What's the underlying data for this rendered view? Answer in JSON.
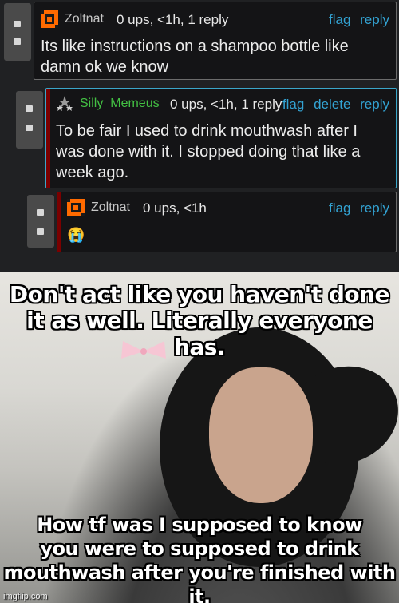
{
  "comments": [
    {
      "user": "Zoltnat",
      "meta": "0 ups, <1h, 1 reply",
      "actions": [
        "flag",
        "reply"
      ],
      "text_lines": [
        "Its like instructions on a shampoo bottle like",
        "damn ok we know"
      ],
      "avatar_icon": "pixel-avatar-icon"
    },
    {
      "user": "Silly_Memeus",
      "meta": "0 ups, <1h, 1 reply",
      "actions": [
        "flag",
        "delete",
        "reply"
      ],
      "text_lines": [
        "To be fair I used to drink mouthwash after I",
        "was done with it. I stopped doing that like a",
        "week ago."
      ],
      "avatar_icon": "stars-avatar-icon"
    },
    {
      "user": "Zoltnat",
      "meta": "0 ups, <1h",
      "actions": [
        "flag",
        "reply"
      ],
      "text_lines": [
        "😭"
      ],
      "avatar_icon": "pixel-avatar-icon"
    }
  ],
  "meme": {
    "top_caption": [
      "Don't act like you haven't done",
      "it as well. Literally everyone has."
    ],
    "bottom_caption": [
      "How tf was I supposed to know",
      "you were to supposed to drink",
      "mouthwash after you're finished with it."
    ],
    "watermark": "imgflip.com"
  },
  "colors": {
    "link": "#33a3d3",
    "accent_bar": "#7a0000",
    "highlight_border": "#3aa6c9",
    "username_green": "#43c043"
  }
}
